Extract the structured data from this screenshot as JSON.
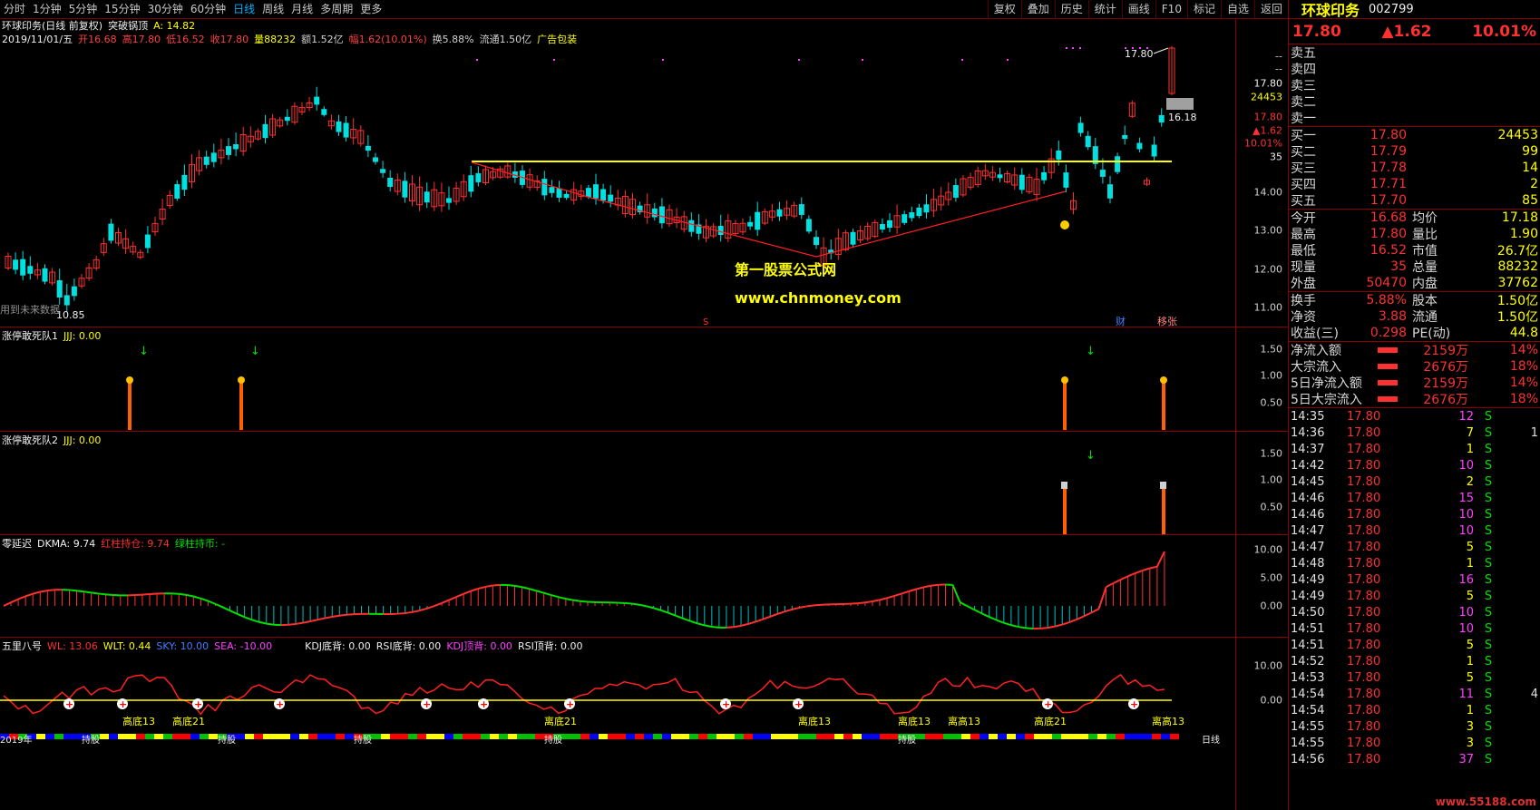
{
  "timeframes": [
    "分时",
    "1分钟",
    "5分钟",
    "15分钟",
    "30分钟",
    "60分钟",
    "日线",
    "周线",
    "月线",
    "多周期",
    "更多"
  ],
  "active_tf": 6,
  "tools": [
    "复权",
    "叠加",
    "历史",
    "统计",
    "画线",
    "F10",
    "标记",
    "自选",
    "返回"
  ],
  "main": {
    "title": "环球印务(日线 前复权)",
    "indicator": "突破锅顶",
    "indicator_val": "A: 14.82",
    "info_date": "2019/11/01/五",
    "info": [
      {
        "t": "开16.68",
        "c": "#ff4040"
      },
      {
        "t": "高17.80",
        "c": "#ff4040"
      },
      {
        "t": "低16.52",
        "c": "#ff4040"
      },
      {
        "t": "收17.80",
        "c": "#ff4040"
      },
      {
        "t": "量88232",
        "c": "#ffff00"
      },
      {
        "t": "额1.52亿",
        "c": "#d0d0d0"
      },
      {
        "t": "幅1.62(10.01%)",
        "c": "#ff4040"
      },
      {
        "t": "换5.88%",
        "c": "#d0d0d0"
      },
      {
        "t": "流通1.50亿",
        "c": "#d0d0d0"
      },
      {
        "t": "广告包装",
        "c": "#ffff00"
      }
    ],
    "axis": [
      "14.00",
      "13.00",
      "12.00",
      "11.00"
    ],
    "axis_top": [
      "--",
      "--",
      "17.80",
      "24453",
      "17.80",
      "▲1.62",
      "10.01%",
      "35"
    ],
    "hi_label": "17.80",
    "lo_label": "10.85",
    "last_label": "16.18",
    "wm1": "第一股票公式网",
    "wm2": "www.chnmoney.com",
    "note": "用到未来数据",
    "tag_cai": "财",
    "tag_yi": "移张",
    "tag_s": "S"
  },
  "p1": {
    "title": "涨停敢死队1",
    "val": "JJJ: 0.00",
    "axis": [
      "1.50",
      "1.00",
      "0.50"
    ]
  },
  "p2": {
    "title": "涨停敢死队2",
    "val": "JJJ: 0.00",
    "axis": [
      "1.50",
      "1.00",
      "0.50"
    ]
  },
  "p3": {
    "title": "零延迟",
    "v1": "DKMA: 9.74",
    "v2": "红柱持仓: 9.74",
    "v3": "绿柱持币: -",
    "axis": [
      "10.00",
      "5.00",
      "0.00"
    ]
  },
  "p4": {
    "title": "五里八号",
    "v1": "WL: 13.06",
    "v2": "WLT: 0.44",
    "v3": "SKY: 10.00",
    "v4": "SEA: -10.00",
    "v5": "KDJ底背: 0.00",
    "v6": "RSI底背: 0.00",
    "v7": "KDJ顶背: 0.00",
    "v8": "RSI顶背: 0.00",
    "axis": [
      "10.00",
      "0.00"
    ],
    "labels": [
      "高底13",
      "高底21",
      "离底21",
      "离底13",
      "离高13",
      "离底13",
      "高底21",
      "离高13"
    ],
    "bottom": [
      "2019年",
      "持股",
      "持股",
      "持股",
      "持股",
      "持股",
      "日线"
    ]
  },
  "side": {
    "name": "环球印务",
    "code": "002799",
    "price": "17.80",
    "chg": "▲1.62",
    "pct": "10.01%",
    "sell": [
      "卖五",
      "卖四",
      "卖三",
      "卖二",
      "卖一"
    ],
    "buy": [
      [
        "买一",
        "17.80",
        "24453"
      ],
      [
        "买二",
        "17.79",
        "99"
      ],
      [
        "买三",
        "17.78",
        "14"
      ],
      [
        "买四",
        "17.71",
        "2"
      ],
      [
        "买五",
        "17.70",
        "85"
      ]
    ],
    "stats": [
      [
        "今开",
        "16.68",
        "均价",
        "17.18"
      ],
      [
        "最高",
        "17.80",
        "量比",
        "1.90"
      ],
      [
        "最低",
        "16.52",
        "市值",
        "26.7亿"
      ],
      [
        "现量",
        "35",
        "总量",
        "88232"
      ],
      [
        "外盘",
        "50470",
        "内盘",
        "37762"
      ]
    ],
    "stats2": [
      [
        "换手",
        "5.88%",
        "股本",
        "1.50亿"
      ],
      [
        "净资",
        "3.88",
        "流通",
        "1.50亿"
      ],
      [
        "收益(三)",
        "0.298",
        "PE(动)",
        "44.8"
      ]
    ],
    "flows": [
      [
        "净流入额",
        "2159万",
        "14%"
      ],
      [
        "大宗流入",
        "2676万",
        "18%"
      ],
      [
        "5日净流入额",
        "2159万",
        "14%"
      ],
      [
        "5日大宗流入",
        "2676万",
        "18%"
      ]
    ],
    "ticks": [
      [
        "14:35",
        "17.80",
        "12",
        "S",
        ""
      ],
      [
        "14:36",
        "17.80",
        "7",
        "S",
        "1"
      ],
      [
        "14:37",
        "17.80",
        "1",
        "S",
        ""
      ],
      [
        "14:42",
        "17.80",
        "10",
        "S",
        ""
      ],
      [
        "14:45",
        "17.80",
        "2",
        "S",
        ""
      ],
      [
        "14:46",
        "17.80",
        "15",
        "S",
        ""
      ],
      [
        "14:46",
        "17.80",
        "10",
        "S",
        ""
      ],
      [
        "14:47",
        "17.80",
        "10",
        "S",
        ""
      ],
      [
        "14:47",
        "17.80",
        "5",
        "S",
        ""
      ],
      [
        "14:48",
        "17.80",
        "1",
        "S",
        ""
      ],
      [
        "14:49",
        "17.80",
        "16",
        "S",
        ""
      ],
      [
        "14:49",
        "17.80",
        "5",
        "S",
        ""
      ],
      [
        "14:50",
        "17.80",
        "10",
        "S",
        ""
      ],
      [
        "14:51",
        "17.80",
        "10",
        "S",
        ""
      ],
      [
        "14:51",
        "17.80",
        "5",
        "S",
        ""
      ],
      [
        "14:52",
        "17.80",
        "1",
        "S",
        ""
      ],
      [
        "14:53",
        "17.80",
        "5",
        "S",
        ""
      ],
      [
        "14:54",
        "17.80",
        "11",
        "S",
        "4"
      ],
      [
        "14:54",
        "17.80",
        "1",
        "S",
        ""
      ],
      [
        "14:55",
        "17.80",
        "3",
        "S",
        ""
      ],
      [
        "14:55",
        "17.80",
        "3",
        "S",
        ""
      ],
      [
        "14:56",
        "17.80",
        "37",
        "S",
        ""
      ]
    ],
    "site": "www.55188.com"
  }
}
